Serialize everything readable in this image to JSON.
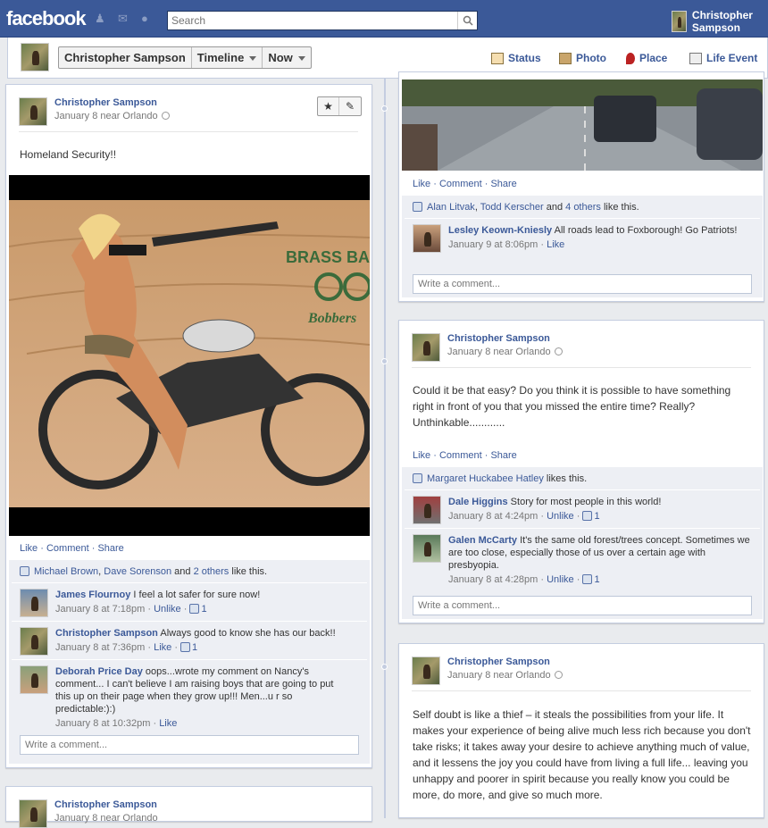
{
  "header": {
    "logo": "facebook",
    "search_placeholder": "Search",
    "user_name": "Christopher Sampson"
  },
  "subbar": {
    "name": "Christopher Sampson",
    "timeline": "Timeline",
    "now": "Now",
    "composer": [
      "Status",
      "Photo",
      "Place",
      "Life Event"
    ]
  },
  "posts": {
    "p1": {
      "author": "Christopher Sampson",
      "meta": "January 8 near Orlando",
      "text": "Homeland Security!!",
      "actions": [
        "Like",
        "Comment",
        "Share"
      ],
      "likes": {
        "a": "Michael Brown",
        "b": "Dave Sorenson",
        "mid": " and ",
        "c": "2 others",
        "tail": " like this."
      },
      "comments": [
        {
          "author": "James Flournoy",
          "text": " I feel a lot safer for sure now!",
          "ts": "January 8 at 7:18pm",
          "act": "Unlike",
          "count": "1"
        },
        {
          "author": "Christopher Sampson",
          "text": " Always good to know she has our back!!",
          "ts": "January 8 at 7:36pm",
          "act": "Like",
          "count": "1"
        },
        {
          "author": "Deborah Price Day",
          "text": " oops...wrote my comment on Nancy's comment... I can't believe I am raising boys that are going to put this up on their page when they grow up!!! Men...u r so predictable:):)",
          "ts": "January 8 at 10:32pm",
          "act": "Like"
        }
      ],
      "write": "Write a comment...",
      "image_text": {
        "brand1": "BRASS BA",
        "brand2": "Bobbers"
      }
    },
    "p2": {
      "actions": [
        "Like",
        "Comment",
        "Share"
      ],
      "likes": {
        "a": "Alan Litvak",
        "b": "Todd Kerscher",
        "mid": " and ",
        "c": "4 others",
        "tail": " like this."
      },
      "comment": {
        "author": "Lesley Keown-Kniesly",
        "text": " All roads lead to Foxborough! Go Patriots!",
        "ts": "January 9 at 8:06pm",
        "act": "Like"
      },
      "write": "Write a comment..."
    },
    "p3": {
      "author": "Christopher Sampson",
      "meta": "January 8 near Orlando",
      "text": "Could it be that easy? Do you think it is possible to have something right in front of you that you missed the entire time? Really? Unthinkable............",
      "actions": [
        "Like",
        "Comment",
        "Share"
      ],
      "likes": {
        "a": "Margaret Huckabee Hatley",
        "tail": " likes this."
      },
      "comments": [
        {
          "author": "Dale Higgins",
          "text": " Story for most people in this world!",
          "ts": "January 8 at 4:24pm",
          "act": "Unlike",
          "count": "1"
        },
        {
          "author": "Galen McCarty",
          "text": " It's the same old forest/trees concept. Sometimes we are too close, especially those of us over a certain age with presbyopia.",
          "ts": "January 8 at 4:28pm",
          "act": "Unlike",
          "count": "1"
        }
      ],
      "write": "Write a comment..."
    },
    "p4": {
      "author": "Christopher Sampson",
      "meta": "January 8 near Orlando",
      "text": "Self doubt is like a thief – it steals the possibilities from your life. It makes your experience of being alive much less rich because you don't take risks; it takes away your desire to achieve anything much of value, and it lessens the joy you could have from living a full life... leaving you unhappy and poorer in spirit because you really know you could be more, do more, and give so much more."
    },
    "p5": {
      "author": "Christopher Sampson",
      "meta": "January 8 near Orlando"
    }
  }
}
